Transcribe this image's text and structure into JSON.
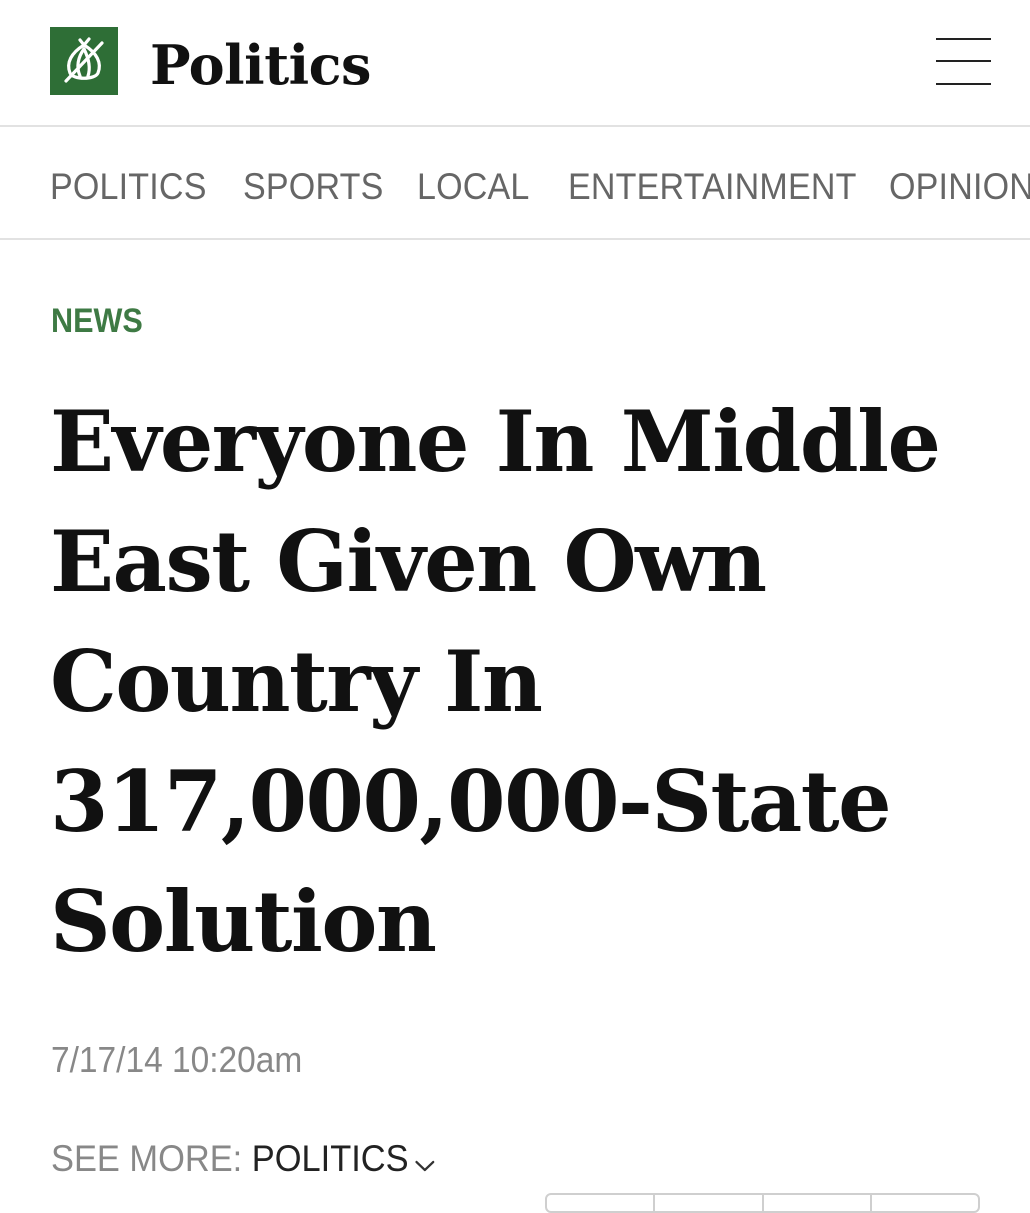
{
  "header": {
    "section_title": "Politics",
    "logo_icon": "onion-icon",
    "menu_icon": "hamburger-menu-icon",
    "brand_color": "#2e6e36"
  },
  "nav": {
    "items": [
      {
        "label": "POLITICS"
      },
      {
        "label": "SPORTS"
      },
      {
        "label": "LOCAL"
      },
      {
        "label": "ENTERTAINMENT"
      },
      {
        "label": "OPINION"
      }
    ]
  },
  "article": {
    "kicker": "NEWS",
    "kicker_color": "#3e7a44",
    "headline": "Everyone In Middle East Given Own Country In 317,000,000-State Solution",
    "timestamp": "7/17/14 10:20am",
    "see_more_label": "SEE MORE:",
    "see_more_link": "POLITICS",
    "see_more_icon": "chevron-down-icon"
  }
}
